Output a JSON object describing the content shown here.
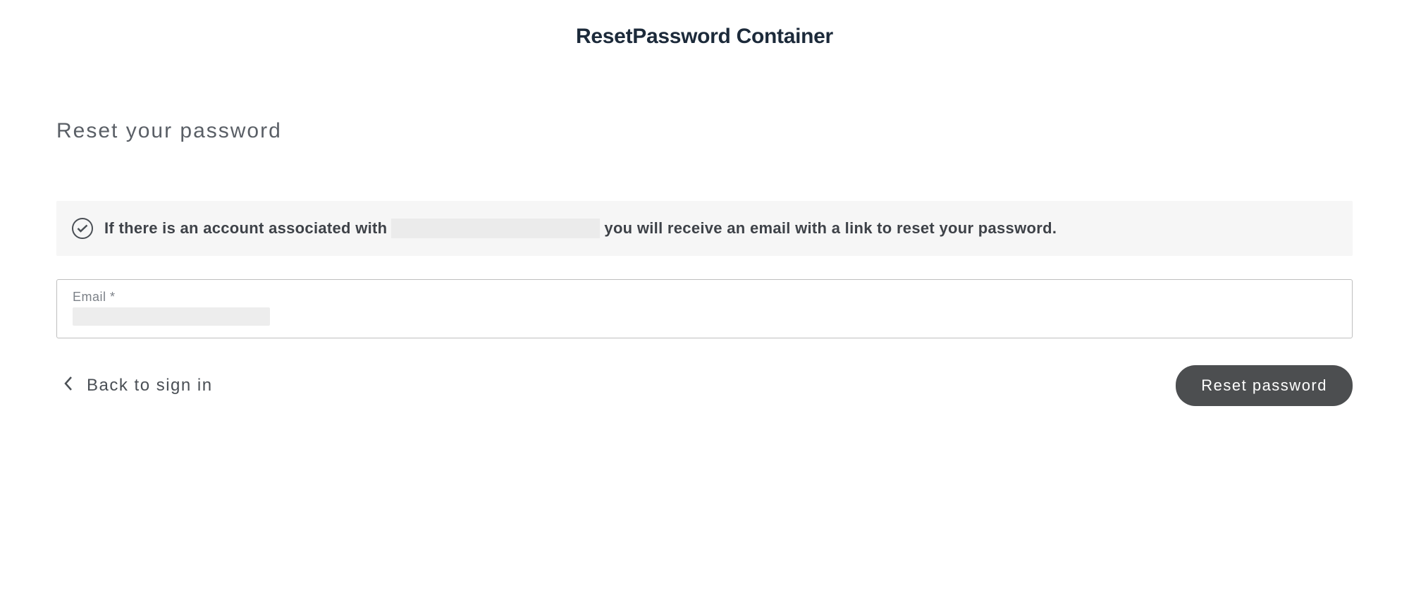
{
  "header": {
    "title": "ResetPassword Container"
  },
  "section": {
    "title": "Reset your password"
  },
  "notice": {
    "prefix": "If there is an account associated with",
    "suffix": "you will receive an email with a link to reset your password."
  },
  "form": {
    "email_label": "Email *",
    "email_value": ""
  },
  "actions": {
    "back_label": "Back to sign in",
    "reset_label": "Reset password"
  }
}
